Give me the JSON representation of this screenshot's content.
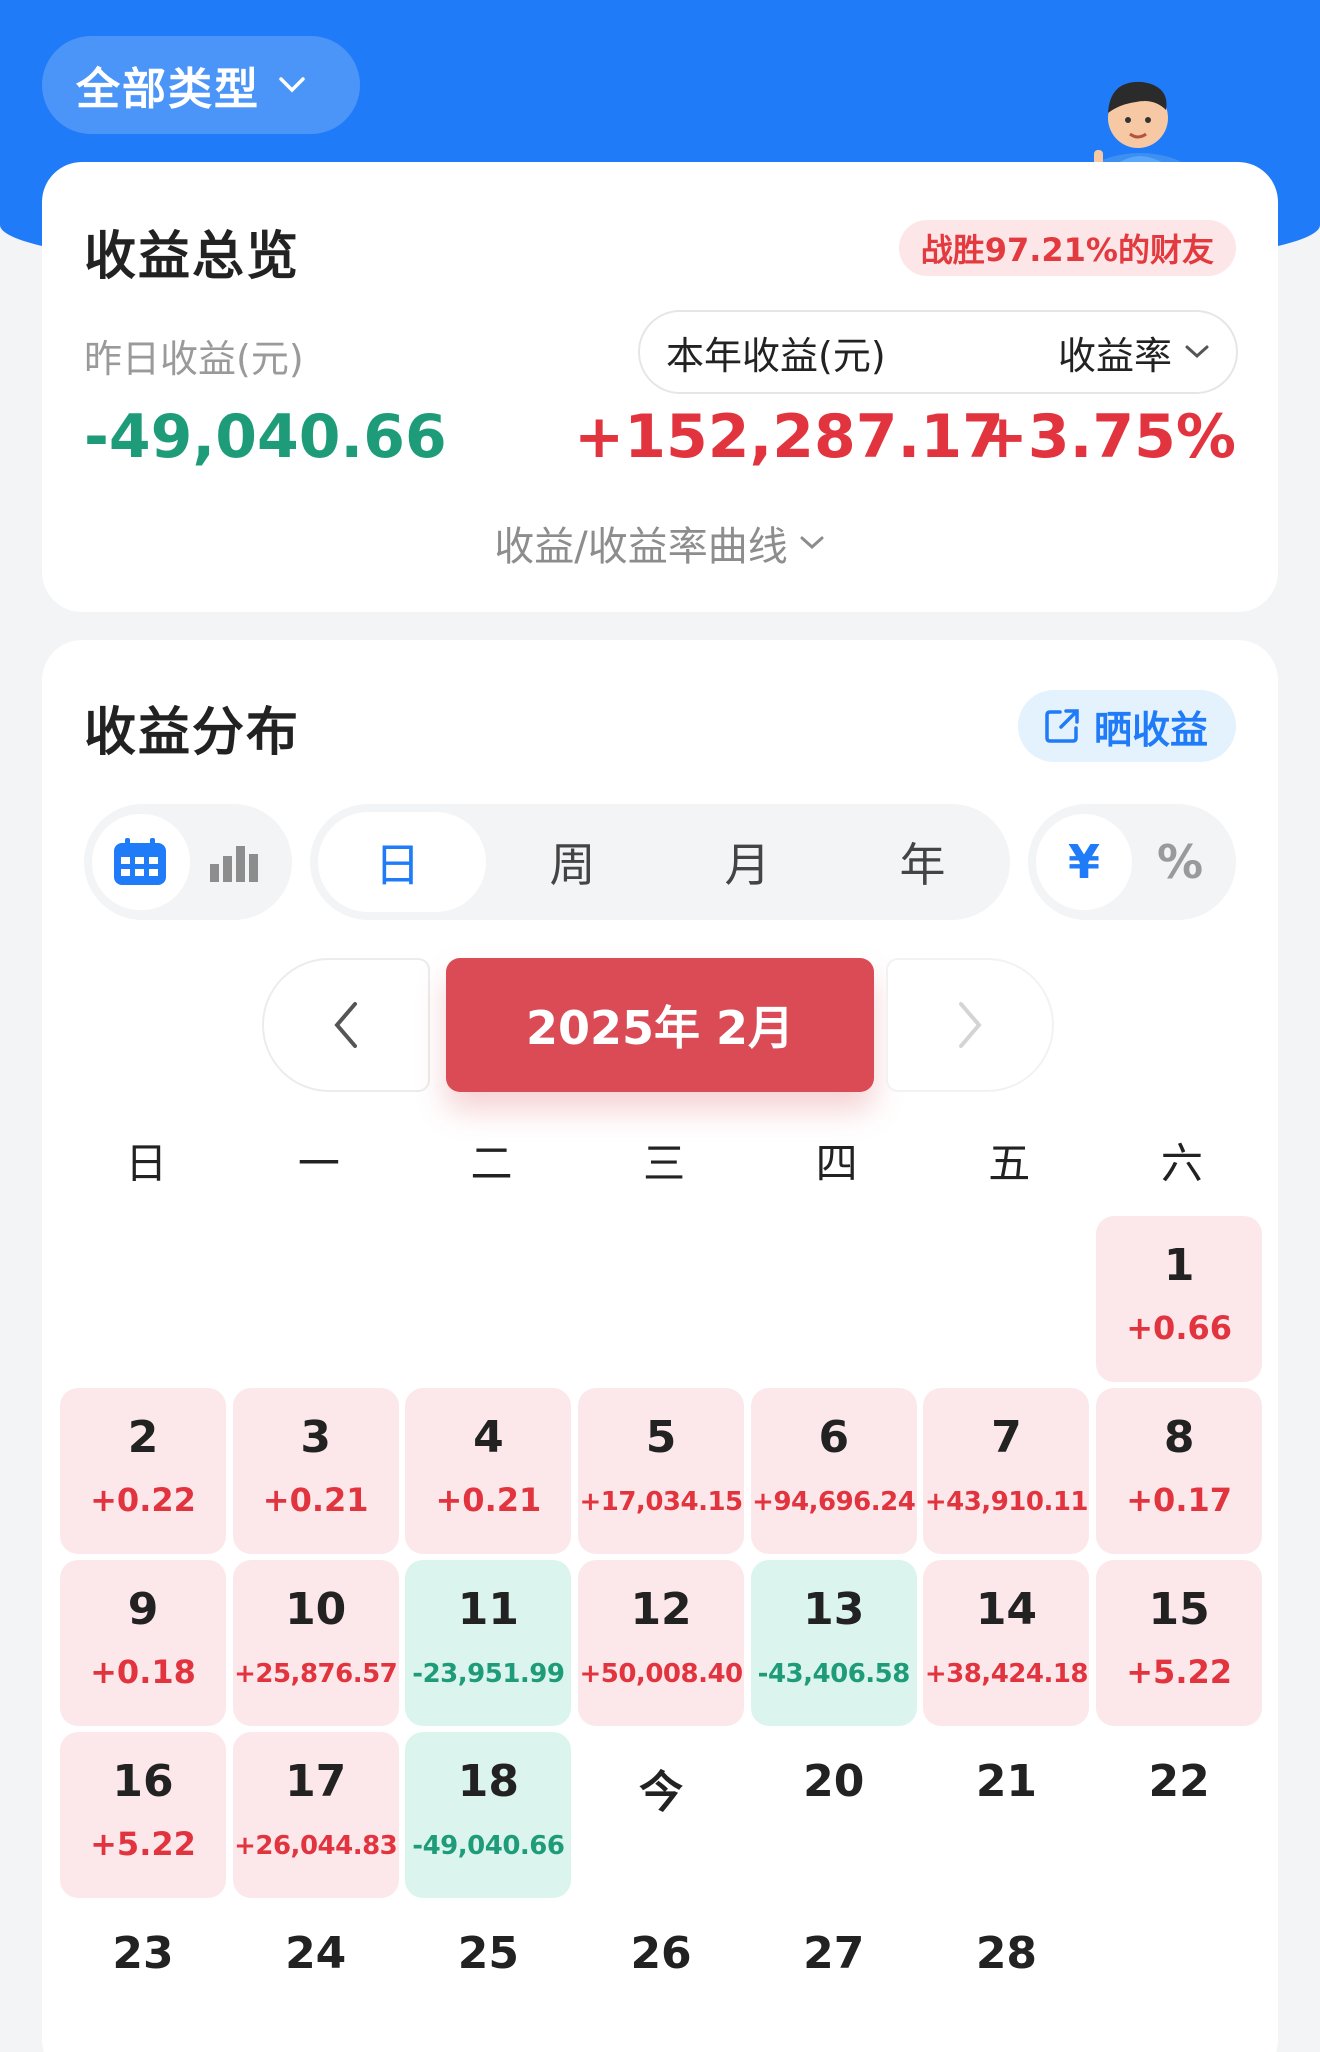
{
  "header": {
    "type_filter": "全部类型",
    "colors": {
      "brand_blue": "#1f7bf7",
      "profit_red": "#e2343e",
      "loss_green": "#1e9c79"
    }
  },
  "overview": {
    "title": "收益总览",
    "rank_badge": "战胜97.21%的财友",
    "yesterday_label": "昨日收益(元)",
    "yesterday_value": "-49,040.66",
    "year_label": "本年收益(元)",
    "year_value": "+152,287.17",
    "rate_label": "收益率",
    "rate_value": "+3.75%",
    "curve_link": "收益/收益率曲线"
  },
  "distribution": {
    "title": "收益分布",
    "share_button": "晒收益",
    "view_toggle": {
      "options": [
        "calendar-icon",
        "bar-chart-icon"
      ],
      "selected": "calendar-icon"
    },
    "periods": [
      "日",
      "周",
      "月",
      "年"
    ],
    "selected_period": "日",
    "units": [
      "¥",
      "%"
    ],
    "selected_unit": "¥",
    "month_title": "2025年 2月",
    "weekdays": [
      "日",
      "一",
      "二",
      "三",
      "四",
      "五",
      "六"
    ],
    "days": [
      {
        "day": "",
        "profit": "",
        "type": "blank"
      },
      {
        "day": "",
        "profit": "",
        "type": "blank"
      },
      {
        "day": "",
        "profit": "",
        "type": "blank"
      },
      {
        "day": "",
        "profit": "",
        "type": "blank"
      },
      {
        "day": "",
        "profit": "",
        "type": "blank"
      },
      {
        "day": "",
        "profit": "",
        "type": "blank"
      },
      {
        "day": "1",
        "profit": "+0.66",
        "type": "pos"
      },
      {
        "day": "2",
        "profit": "+0.22",
        "type": "pos"
      },
      {
        "day": "3",
        "profit": "+0.21",
        "type": "pos"
      },
      {
        "day": "4",
        "profit": "+0.21",
        "type": "pos"
      },
      {
        "day": "5",
        "profit": "+17,034.15",
        "type": "pos"
      },
      {
        "day": "6",
        "profit": "+94,696.24",
        "type": "pos"
      },
      {
        "day": "7",
        "profit": "+43,910.11",
        "type": "pos"
      },
      {
        "day": "8",
        "profit": "+0.17",
        "type": "pos"
      },
      {
        "day": "9",
        "profit": "+0.18",
        "type": "pos"
      },
      {
        "day": "10",
        "profit": "+25,876.57",
        "type": "pos"
      },
      {
        "day": "11",
        "profit": "-23,951.99",
        "type": "neg"
      },
      {
        "day": "12",
        "profit": "+50,008.40",
        "type": "pos"
      },
      {
        "day": "13",
        "profit": "-43,406.58",
        "type": "neg"
      },
      {
        "day": "14",
        "profit": "+38,424.18",
        "type": "pos"
      },
      {
        "day": "15",
        "profit": "+5.22",
        "type": "pos"
      },
      {
        "day": "16",
        "profit": "+5.22",
        "type": "pos"
      },
      {
        "day": "17",
        "profit": "+26,044.83",
        "type": "pos"
      },
      {
        "day": "18",
        "profit": "-49,040.66",
        "type": "neg"
      },
      {
        "day": "今",
        "profit": "",
        "type": "empty"
      },
      {
        "day": "20",
        "profit": "",
        "type": "empty"
      },
      {
        "day": "21",
        "profit": "",
        "type": "empty"
      },
      {
        "day": "22",
        "profit": "",
        "type": "empty"
      },
      {
        "day": "23",
        "profit": "",
        "type": "empty"
      },
      {
        "day": "24",
        "profit": "",
        "type": "empty"
      },
      {
        "day": "25",
        "profit": "",
        "type": "empty"
      },
      {
        "day": "26",
        "profit": "",
        "type": "empty"
      },
      {
        "day": "27",
        "profit": "",
        "type": "empty"
      },
      {
        "day": "28",
        "profit": "",
        "type": "empty"
      }
    ]
  }
}
